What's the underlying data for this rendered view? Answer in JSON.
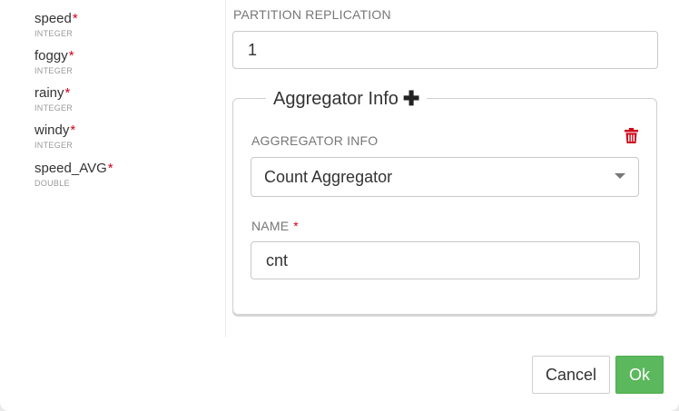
{
  "fields": [
    {
      "name": "speed",
      "type": "INTEGER"
    },
    {
      "name": "foggy",
      "type": "INTEGER"
    },
    {
      "name": "rainy",
      "type": "INTEGER"
    },
    {
      "name": "windy",
      "type": "INTEGER"
    },
    {
      "name": "speed_AVG",
      "type": "DOUBLE"
    }
  ],
  "required_marker": "*",
  "partition_replication": {
    "label": "PARTITION REPLICATION",
    "value": "1"
  },
  "aggregator": {
    "legend": "Aggregator Info",
    "plus_icon": "plus-icon",
    "delete_icon": "trash-icon",
    "info_label": "AGGREGATOR INFO",
    "info_value": "Count Aggregator",
    "name_label": "NAME",
    "name_value": "cnt"
  },
  "buttons": {
    "cancel": "Cancel",
    "ok": "Ok"
  },
  "colors": {
    "ok": "#5cb85c",
    "required": "#d0021b",
    "delete": "#d0021b"
  }
}
